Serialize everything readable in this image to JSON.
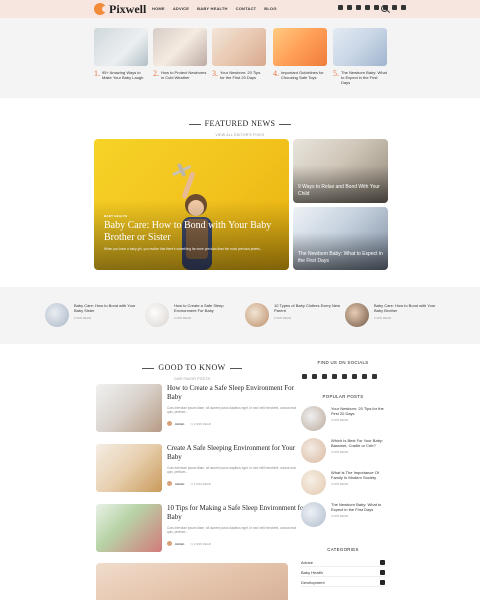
{
  "header": {
    "logo_text": "Pixwell",
    "nav": [
      "HOME",
      "ADVICE",
      "BABY HEALTH",
      "CONTACT",
      "BLOG"
    ],
    "social_icons": [
      "facebook-icon",
      "twitter-icon",
      "pinterest-icon",
      "instagram-icon",
      "vk-icon",
      "tumblr-icon",
      "dribbble-icon",
      "flickr-icon"
    ],
    "accent": "#e8743b"
  },
  "top_strip": [
    {
      "num": "1.",
      "title": "95+ Amazing Ways to Make Your Baby Laugh"
    },
    {
      "num": "2.",
      "title": "How to Protect Newborns in Cold Weather"
    },
    {
      "num": "3.",
      "title": "Your Newborn: 20 Tips for the First 20 Days"
    },
    {
      "num": "4.",
      "title": "Important Guidelines for Choosing Safe Toys"
    },
    {
      "num": "5.",
      "title": "The Newborn Baby: What to Expect in the First Days"
    }
  ],
  "featured": {
    "title": "FEATURED NEWS",
    "subtitle": "VIEW ALL EDITOR'S PICKS",
    "main": {
      "category": "BABY HEALTH",
      "title": "Baby Care: How to Bond with Your Baby Brother or Sister",
      "excerpt": "When you have a baby girl, you realize that there's something far more precious than the most precious jewels..."
    },
    "side": [
      {
        "title": "9 Ways to Relax and Bond With Your Child"
      },
      {
        "title": "The Newborn Baby: What to Expect in the First Days"
      }
    ]
  },
  "band": [
    {
      "title": "Baby Care: How to Bond with Your Baby Sister",
      "meta": "2 MIN READ"
    },
    {
      "title": "How to Create a Safe Sleep Environment For Baby",
      "meta": "2 MIN READ"
    },
    {
      "title": "10 Types of Baby Clothes Every New Parent",
      "meta": "2 MIN READ"
    },
    {
      "title": "Baby Care: How to Bond with Your Baby Brother",
      "meta": "2 MIN READ"
    }
  ],
  "good_to_know": {
    "title": "GOOD TO KNOW",
    "subtitle": "OUR FAVOR POSTS",
    "posts": [
      {
        "title": "How to Create a Safe Sleep Environment For Baby",
        "excerpt": "Cras interdum ipsum diam, sit laoreet purus dapibus eget. In sed velit hendrerit, cursus erat quis, pretium...",
        "author": "Admin",
        "time": "2 MIN READ"
      },
      {
        "title": "Create A Safe Sleeping Environment for Your Baby",
        "excerpt": "Cras interdum ipsum diam, sit laoreet purus dapibus eget. In sed velit hendrerit, cursus erat quis, pretium...",
        "author": "Admin",
        "time": "2 MIN READ"
      },
      {
        "title": "10 Tips for Making a Safe Sleep Environment for Baby",
        "excerpt": "Cras interdum ipsum diam, sit laoreet purus dapibus eget. In sed velit hendrerit, cursus erat quis, pretium...",
        "author": "Admin",
        "time": "2 MIN READ"
      }
    ]
  },
  "sidebar": {
    "socials_title": "FIND US ON SOCIALS",
    "popular_title": "POPULAR POSTS",
    "popular": [
      {
        "title": "Your Newborn: 20 Tips for the First 20 Days",
        "meta": "2 MIN READ"
      },
      {
        "title": "Which Is Best For Your Baby: Bassinet, Cradle or Crib?",
        "meta": "2 MIN READ"
      },
      {
        "title": "What Is The Importance Of Family In Modern Society",
        "meta": "2 MIN READ"
      },
      {
        "title": "The Newborn Baby: What to Expect in the First Days",
        "meta": "2 MIN READ"
      }
    ],
    "categories_title": "CATEGORIES",
    "categories": [
      {
        "name": "Advice",
        "count": "8"
      },
      {
        "name": "Baby Health",
        "count": "8"
      },
      {
        "name": "Development",
        "count": "8"
      }
    ]
  }
}
